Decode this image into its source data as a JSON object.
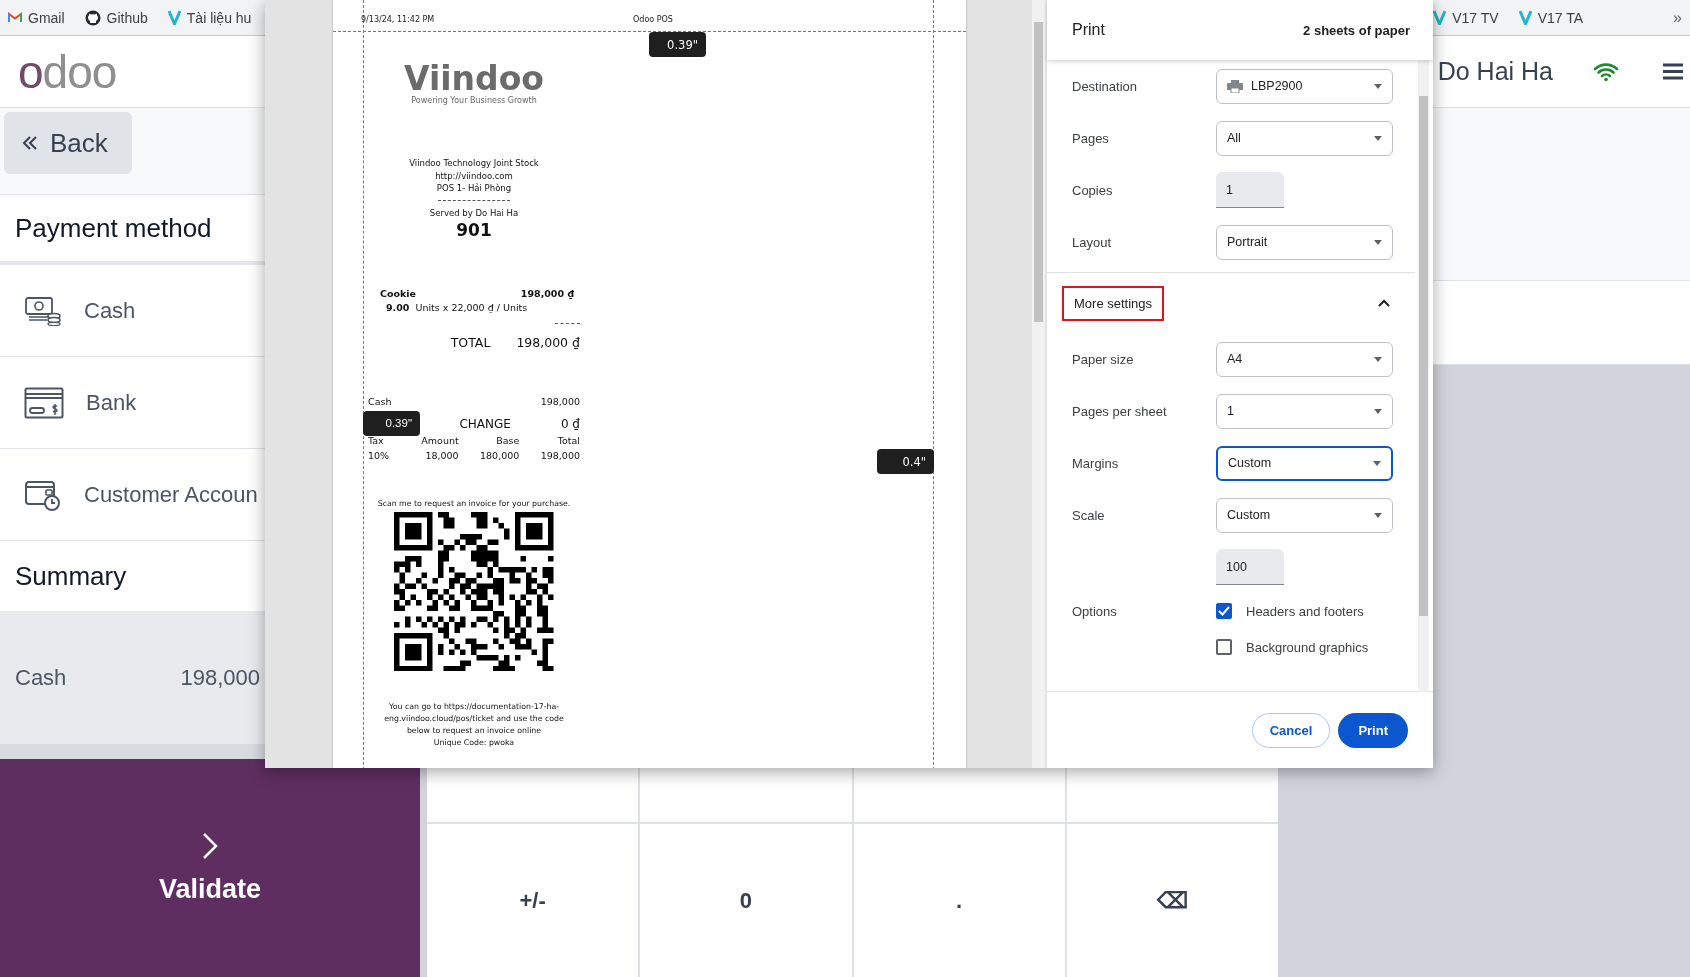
{
  "bookmarks": [
    {
      "label": "Gmail",
      "kind": "mail"
    },
    {
      "label": "Github",
      "kind": "github"
    },
    {
      "label": "Tài liệu hu",
      "kind": "v"
    }
  ],
  "bookmarks_right": [
    {
      "label": "V17 TV",
      "kind": "v"
    },
    {
      "label": "V17 TA",
      "kind": "v"
    }
  ],
  "bookmarks_more": "»",
  "app_logo": "odoo",
  "user": {
    "name": "Do Hai Ha"
  },
  "back_button": "Back",
  "payment_methods": {
    "title": "Payment method",
    "items": [
      {
        "label": "Cash",
        "kind": "cash"
      },
      {
        "label": "Bank",
        "kind": "bank"
      },
      {
        "label": "Customer Accoun",
        "kind": "account"
      }
    ]
  },
  "summary": {
    "title": "Summary",
    "lines": [
      {
        "method": "Cash",
        "amount": "198,000"
      }
    ]
  },
  "validate": "Validate",
  "keypad": {
    "rows": [
      [
        "",
        "",
        "",
        ""
      ],
      [
        "+/-",
        "0",
        ".",
        "⌫"
      ]
    ]
  },
  "print_dialog": {
    "preview": {
      "page_header": {
        "date": "9/13/24, 11:42 PM",
        "title": "Odoo POS"
      },
      "margin_labels": [
        "0.39\"",
        "0.39\"",
        "0.4\""
      ],
      "receipt": {
        "logo": {
          "name": "Viindoo",
          "tagline": "Powering Your Business Growth"
        },
        "company_lines": [
          "Viindoo Technology Joint Stock",
          "http://viindoo.com",
          "POS 1- Hải Phòng"
        ],
        "served_by": "Served by Do Hai Ha",
        "order_number": "901",
        "lines": [
          {
            "product": "Cookie",
            "price": "198,000 ₫",
            "qty": "9.00",
            "unit_text": "Units x 22,000 ₫ / Units"
          }
        ],
        "total": {
          "label": "TOTAL",
          "value": "198,000 ₫"
        },
        "payments": [
          {
            "method": "Cash",
            "amount": "198,000"
          }
        ],
        "change": {
          "label": "CHANGE",
          "value": "0 ₫"
        },
        "tax_table": {
          "columns": [
            "Tax",
            "Amount",
            "Base",
            "Total"
          ],
          "rows": [
            [
              "10%",
              "18,000",
              "180,000",
              "198,000"
            ]
          ]
        },
        "qr_caption": "Scan me to request an invoice for your purchase.",
        "invoice_note": "You can go to https://documentation-17-ha-eng.viindoo.cloud/pos/ticket and use the code below to request an invoice online",
        "unique_code": "Unique Code: pwoka"
      }
    },
    "title": "Print",
    "sheets": "2 sheets of paper",
    "settings": [
      {
        "kind": "destination",
        "label": "Destination",
        "value": "LBP2900"
      },
      {
        "kind": "select",
        "label": "Pages",
        "value": "All",
        "focused": false
      },
      {
        "kind": "number",
        "label": "Copies",
        "value": "1"
      },
      {
        "kind": "select",
        "label": "Layout",
        "value": "Portrait",
        "focused": false
      }
    ],
    "more_settings": {
      "label": "More settings",
      "expanded": true,
      "highlighted": true
    },
    "more": [
      {
        "kind": "select",
        "label": "Paper size",
        "value": "A4",
        "focused": false
      },
      {
        "kind": "select",
        "label": "Pages per sheet",
        "value": "1",
        "focused": false
      },
      {
        "kind": "select",
        "label": "Margins",
        "value": "Custom",
        "focused": true
      },
      {
        "kind": "select",
        "label": "Scale",
        "value": "Custom",
        "focused": false
      },
      {
        "kind": "number",
        "value": "100"
      }
    ],
    "options": {
      "label": "Options",
      "items": [
        {
          "label": "Headers and footers",
          "checked": true
        },
        {
          "label": "Background graphics",
          "checked": false
        }
      ]
    },
    "buttons": [
      {
        "label": "Cancel",
        "kind": "secondary"
      },
      {
        "label": "Print",
        "kind": "primary"
      }
    ]
  }
}
